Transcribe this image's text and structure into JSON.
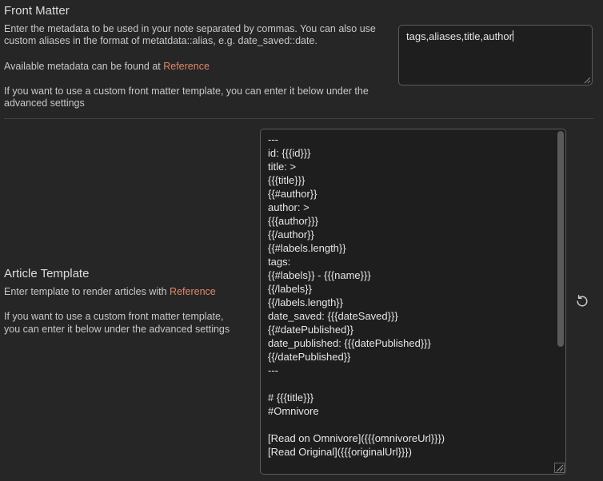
{
  "front_matter": {
    "title": "Front Matter",
    "desc_line1": "Enter the metadata to be used in your note separated by commas. You can also use",
    "desc_line2": "custom aliases in the format of metatdata::alias, e.g. date_saved::date.",
    "available_prefix": "Available metadata can be found at ",
    "reference_link": "Reference",
    "custom_line1": "If you want to use a custom front matter template, you can enter it below under the",
    "custom_line2": "advanced settings",
    "input_value": "tags,aliases,title,author"
  },
  "article_template": {
    "title": "Article Template",
    "desc_prefix": "Enter template to render articles with ",
    "reference_link": "Reference",
    "custom_line1": "If you want to use a custom front matter template,",
    "custom_line2": "you can enter it below under the advanced settings",
    "template_value": "---\nid: {{{id}}}\ntitle: >\n{{{title}}}\n{{#author}}\nauthor: >\n{{{author}}}\n{{/author}}\n{{#labels.length}}\ntags:\n{{#labels}} - {{{name}}}\n{{/labels}}\n{{/labels.length}}\ndate_saved: {{{dateSaved}}}\n{{#datePublished}}\ndate_published: {{{datePublished}}}\n{{/datePublished}}\n---\n\n# {{{title}}}\n#Omnivore\n\n[Read on Omnivore]({{{omnivoreUrl}}})\n[Read Original]({{{originalUrl}}})\n\n{{#highlights.length}}",
    "reset_icon": "reset-icon"
  }
}
